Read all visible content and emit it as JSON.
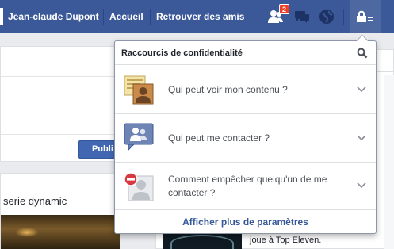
{
  "topbar": {
    "user_name": "Jean-claude Dupont",
    "home_label": "Accueil",
    "find_friends_label": "Retrouver des amis",
    "friend_requests_count": "2",
    "colors": {
      "bar": "#3b5998",
      "badge": "#f03d25"
    }
  },
  "background": {
    "publish_label": "Publi",
    "feed_text": "serie dynamic",
    "game_text": "joue à Top Eleven."
  },
  "privacy_menu": {
    "title": "Raccourcis de confidentialité",
    "search_icon": "search-icon",
    "items": [
      {
        "label": "Qui peut voir mon contenu ?",
        "icon": "content-visibility-icon"
      },
      {
        "label": "Qui peut me contacter ?",
        "icon": "contact-icon"
      },
      {
        "label": "Comment empêcher quelqu'un de me contacter ?",
        "icon": "block-user-icon"
      }
    ],
    "footer_link": "Afficher plus de paramètres"
  }
}
